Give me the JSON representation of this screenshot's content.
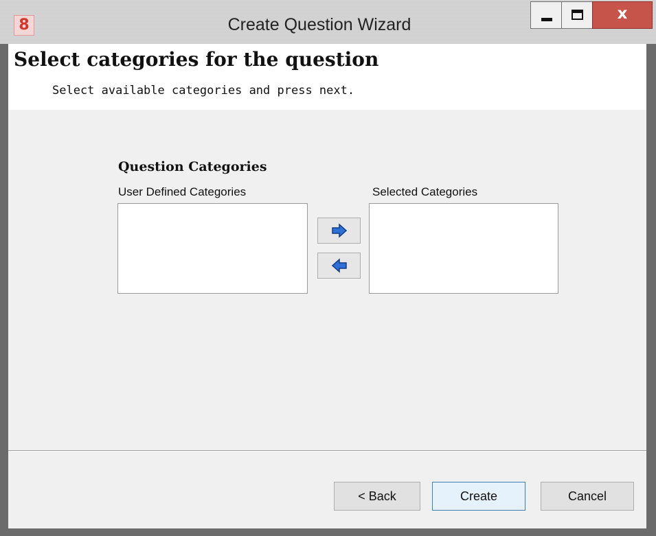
{
  "window": {
    "title": "Create Question Wizard",
    "app_icon_glyph": "8",
    "icons": {
      "app": "app-logo-icon",
      "minimize": "minimize-icon",
      "maximize": "maximize-icon",
      "close": "close-icon"
    },
    "close_glyph": "x"
  },
  "header": {
    "title": "Select categories for the question",
    "subtitle": "Select available categories and press next."
  },
  "categories": {
    "group_title": "Question Categories",
    "available_label": "User Defined Categories",
    "selected_label": "Selected Categories",
    "available_items": [],
    "selected_items": [],
    "add_icon": "arrow-right-icon",
    "remove_icon": "arrow-left-icon"
  },
  "buttons": {
    "back": "< Back",
    "create": "Create",
    "cancel": "Cancel"
  },
  "colors": {
    "arrow_fill": "#2f6fd6",
    "close_button": "#c7544b",
    "default_button_border": "#3c7fb1"
  }
}
